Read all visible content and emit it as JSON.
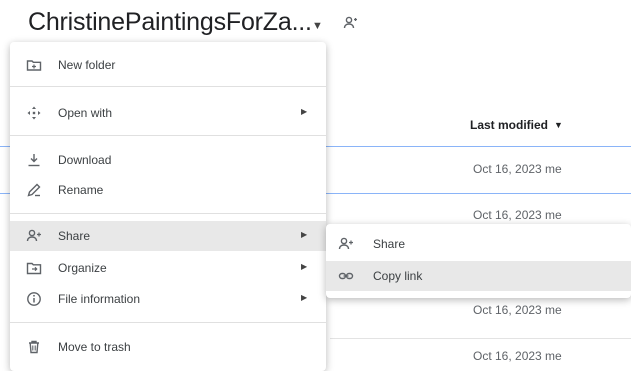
{
  "header": {
    "folder_title": "ChristinePaintingsForZa...",
    "dropdown_caret": "▼",
    "share_icon": "person-icon"
  },
  "file_list": {
    "columns": {
      "last_modified": "Last modified",
      "sort_caret": "▼"
    },
    "rows": [
      {
        "modified": "Oct 16, 2023 me",
        "selected": true
      },
      {
        "modified": "Oct 16, 2023 me",
        "selected": false
      },
      {
        "modified": "Oct 16, 2023 me",
        "selected": false
      },
      {
        "modified": "Oct 16, 2023 me",
        "selected": false
      }
    ]
  },
  "context_menu": {
    "items": [
      {
        "label": "New folder",
        "icon": "new-folder-icon"
      },
      {
        "label": "Open with",
        "icon": "open-with-icon",
        "submenu_arrow": "▶"
      },
      {
        "label": "Download",
        "icon": "download-icon"
      },
      {
        "label": "Rename",
        "icon": "rename-icon"
      },
      {
        "label": "Share",
        "icon": "share-icon",
        "submenu_arrow": "▶",
        "highlighted": true
      },
      {
        "label": "Organize",
        "icon": "organize-icon",
        "submenu_arrow": "▶"
      },
      {
        "label": "File information",
        "icon": "info-icon",
        "submenu_arrow": "▶"
      },
      {
        "label": "Move to trash",
        "icon": "trash-icon"
      }
    ]
  },
  "share_submenu": {
    "items": [
      {
        "label": "Share",
        "icon": "share-icon"
      },
      {
        "label": "Copy link",
        "icon": "link-icon",
        "highlighted": true
      }
    ]
  },
  "colors": {
    "highlight": "#e8e8e8",
    "selected_border": "#8ab4f8",
    "text": "#3c4043",
    "muted_text": "#5f6368"
  }
}
